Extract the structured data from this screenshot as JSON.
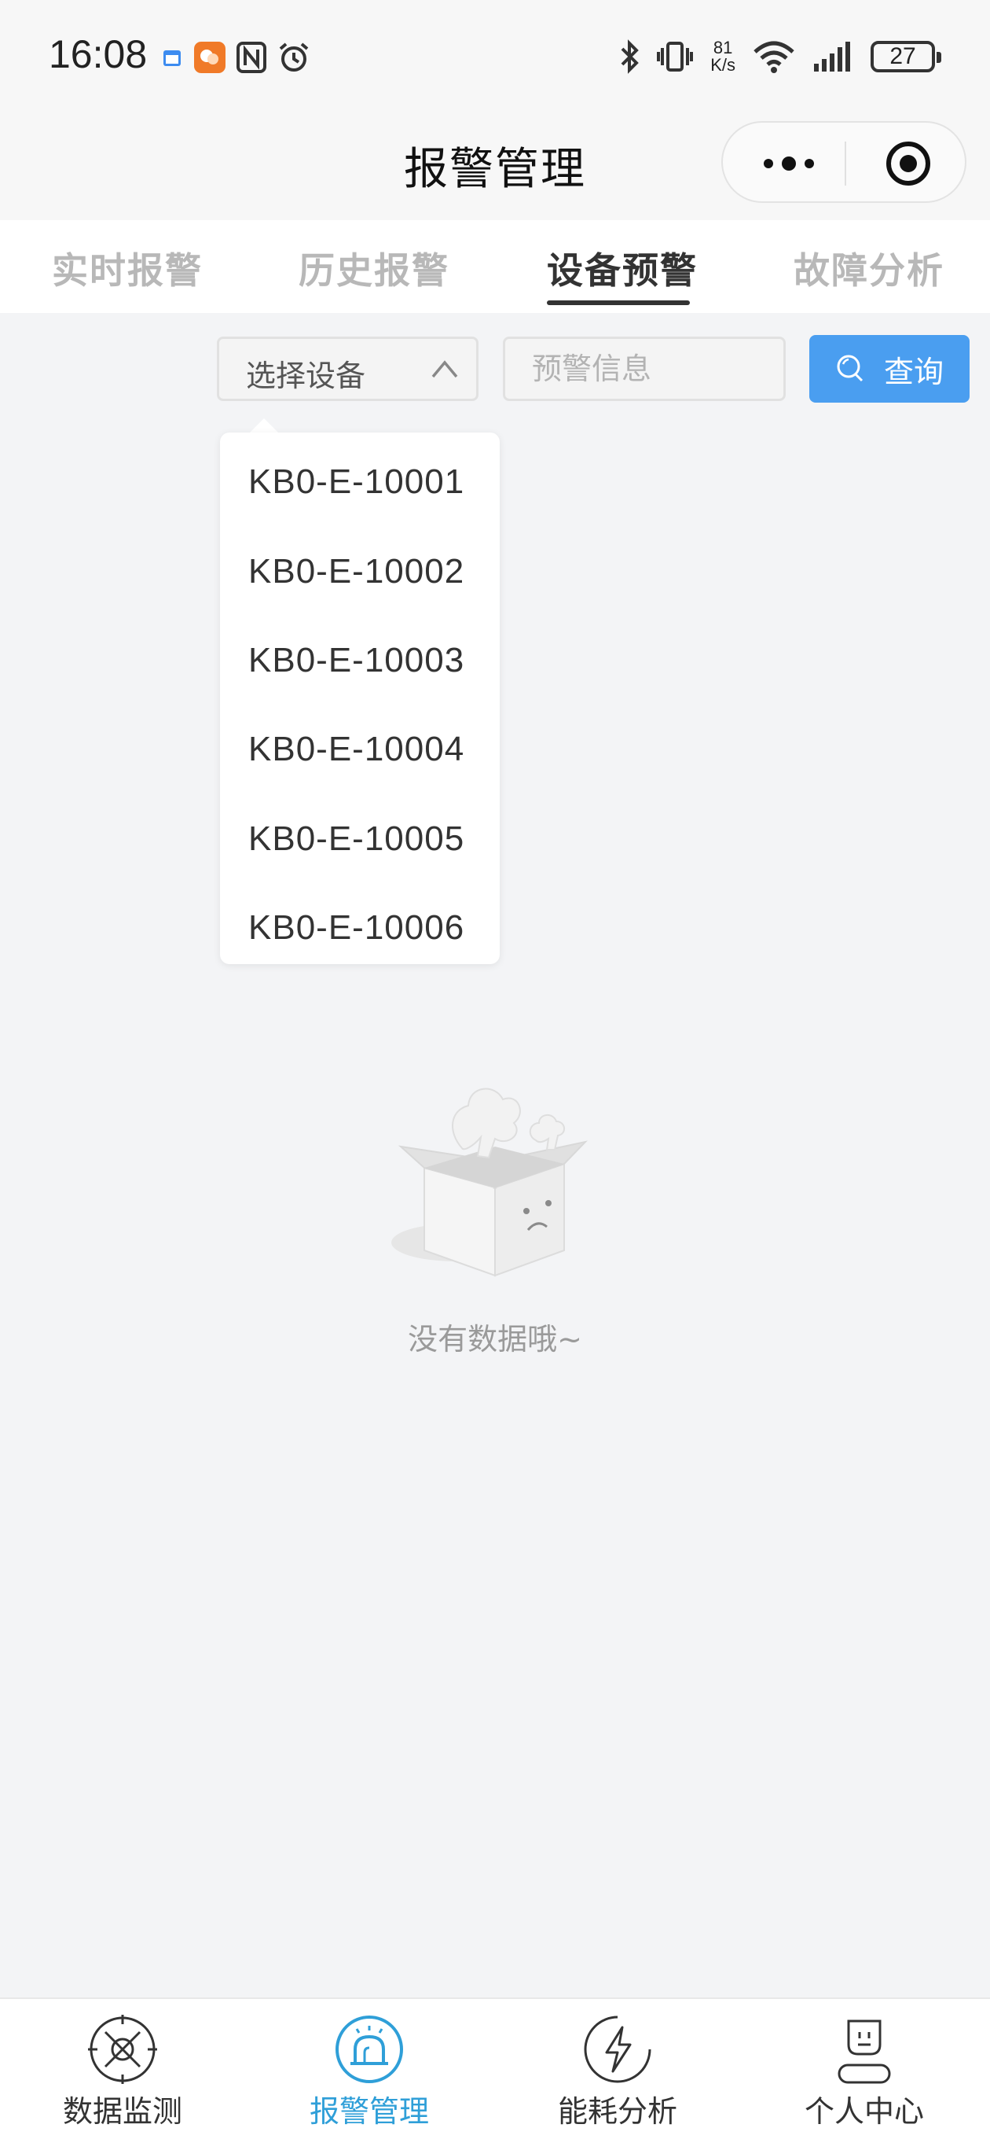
{
  "status_bar": {
    "time": "16:08",
    "network_speed_value": "81",
    "network_speed_unit": "K/s",
    "battery": "27"
  },
  "nav": {
    "title": "报警管理"
  },
  "tabs": [
    {
      "label": "实时报警",
      "active": false
    },
    {
      "label": "历史报警",
      "active": false
    },
    {
      "label": "设备预警",
      "active": true
    },
    {
      "label": "故障分析",
      "active": false
    }
  ],
  "filter": {
    "select_label": "选择设备",
    "info_placeholder": "预警信息",
    "query_label": "查询"
  },
  "dropdown": {
    "options": [
      "KB0-E-10001",
      "KB0-E-10002",
      "KB0-E-10003",
      "KB0-E-10004",
      "KB0-E-10005",
      "KB0-E-10006"
    ]
  },
  "empty": {
    "text": "没有数据哦~"
  },
  "bottom_nav": [
    {
      "label": "数据监测",
      "icon": "monitor-icon",
      "active": false
    },
    {
      "label": "报警管理",
      "icon": "alarm-icon",
      "active": true
    },
    {
      "label": "能耗分析",
      "icon": "energy-icon",
      "active": false
    },
    {
      "label": "个人中心",
      "icon": "user-icon",
      "active": false
    }
  ],
  "colors": {
    "accent": "#4a9ef0",
    "active_nav": "#2f9fd8",
    "background": "#f3f4f6"
  }
}
